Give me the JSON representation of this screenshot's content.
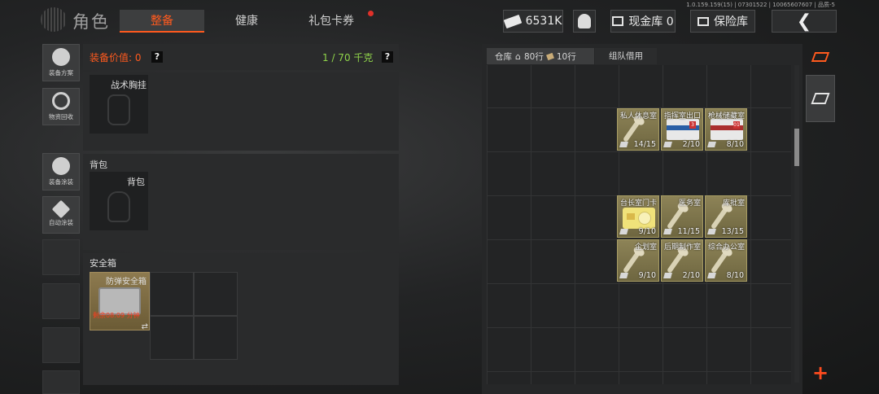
{
  "version": "1.0.159.159(15) | 07301522 | 10065607607 | 品质-5",
  "header": {
    "title": "角色",
    "tabs": [
      {
        "label": "整备",
        "active": true
      },
      {
        "label": "健康",
        "active": false
      },
      {
        "label": "礼包卡券",
        "active": false,
        "badge": true
      }
    ],
    "money": "6531K",
    "cash_vault": "现金库 0",
    "insurance": "保险库",
    "back_icon": "chevron-left-icon"
  },
  "sidebar": [
    {
      "label": "装备方案",
      "icon": "loadout-icon"
    },
    {
      "label": "物资回收",
      "icon": "recycle-icon"
    },
    {
      "label": "装备涂装",
      "icon": "paint-helmet-icon"
    },
    {
      "label": "自动涂装",
      "icon": "auto-paint-icon"
    }
  ],
  "loadout": {
    "value_label": "装备价值: 0",
    "weight": "1 / 70 千克",
    "help": "?",
    "chest_rig": "战术胸挂",
    "backpack_section": "背包",
    "backpack_slot": "背包",
    "safe_section": "安全箱",
    "safe_item": "防弹安全箱",
    "safe_timer": "剩余08:09 分钟",
    "swap_icon": "⇄"
  },
  "warehouse": {
    "tabs": [
      {
        "label": "仓库",
        "extra": "80行",
        "extra2": "10行"
      },
      {
        "label": "组队借用"
      }
    ],
    "items": [
      {
        "name": "私人休息室",
        "count": "14/15",
        "kind": "key"
      },
      {
        "name": "指挥室出口",
        "count": "2/10",
        "kind": "card",
        "badge": "3"
      },
      {
        "name": "枪械储藏室",
        "count": "8/10",
        "kind": "card",
        "badge": "01"
      },
      {
        "name": "台长室门卡",
        "count": "9/10",
        "kind": "ycard"
      },
      {
        "name": "医务室",
        "count": "11/15",
        "kind": "key"
      },
      {
        "name": "库批室",
        "count": "13/15",
        "kind": "key"
      },
      {
        "name": "企划室",
        "count": "9/10",
        "kind": "key"
      },
      {
        "name": "后期制作室",
        "count": "2/10",
        "kind": "key"
      },
      {
        "name": "综合办公室",
        "count": "8/10",
        "kind": "key"
      }
    ],
    "add_icon": "+"
  },
  "colors": {
    "accent": "#ff5a1e",
    "weight_green": "#8fd44a",
    "item_gold": "#8d8357"
  }
}
